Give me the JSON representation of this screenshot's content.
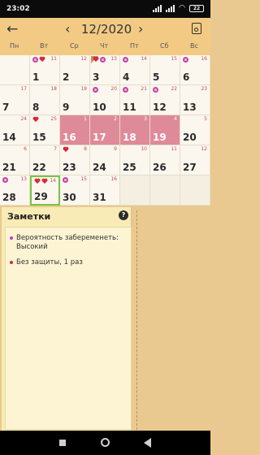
{
  "status_bar": {
    "time": "23:02",
    "battery": "22",
    "icons": [
      "signal-icon",
      "signal-icon",
      "wifi-icon",
      "battery-icon"
    ]
  },
  "header": {
    "back_icon": "arrow-left-icon",
    "prev_icon": "chevron-left-icon",
    "month_year": "12/2020",
    "next_icon": "chevron-right-icon",
    "calendar_icon": "calendar-settings-icon"
  },
  "weekdays": [
    "Пн",
    "Вт",
    "Ср",
    "Чт",
    "Пт",
    "Сб",
    "Вс"
  ],
  "calendar": {
    "weeks": [
      [
        {
          "day": "",
          "sup": ""
        },
        {
          "day": "1",
          "sup": "11",
          "icons": [
            "ring",
            "heart"
          ]
        },
        {
          "day": "2",
          "sup": "12"
        },
        {
          "day": "3",
          "sup": "13",
          "icons": [
            "heart",
            "ring"
          ],
          "note": true
        },
        {
          "day": "4",
          "sup": "14",
          "icons": [
            "ring"
          ]
        },
        {
          "day": "5",
          "sup": "15"
        },
        {
          "day": "6",
          "sup": "16",
          "icons": [
            "ring"
          ]
        }
      ],
      [
        {
          "day": "7",
          "sup": "17"
        },
        {
          "day": "8",
          "sup": "18"
        },
        {
          "day": "9",
          "sup": "19"
        },
        {
          "day": "10",
          "sup": "20",
          "icons": [
            "ring"
          ]
        },
        {
          "day": "11",
          "sup": "21",
          "icons": [
            "ring"
          ]
        },
        {
          "day": "12",
          "sup": "22",
          "icons": [
            "ring"
          ]
        },
        {
          "day": "13",
          "sup": "23"
        }
      ],
      [
        {
          "day": "14",
          "sup": "24"
        },
        {
          "day": "15",
          "sup": "25",
          "icons": [
            "heart"
          ]
        },
        {
          "day": "16",
          "sup": "1",
          "pink": true
        },
        {
          "day": "17",
          "sup": "2",
          "pink": true
        },
        {
          "day": "18",
          "sup": "3",
          "pink": true
        },
        {
          "day": "19",
          "sup": "4",
          "pink": true
        },
        {
          "day": "20",
          "sup": "5"
        }
      ],
      [
        {
          "day": "21",
          "sup": "6"
        },
        {
          "day": "22",
          "sup": "7"
        },
        {
          "day": "23",
          "sup": "8",
          "icons": [
            "heart"
          ]
        },
        {
          "day": "24",
          "sup": "9"
        },
        {
          "day": "25",
          "sup": "10"
        },
        {
          "day": "26",
          "sup": "11"
        },
        {
          "day": "27",
          "sup": "12"
        }
      ],
      [
        {
          "day": "28",
          "sup": "13",
          "icons": [
            "ring"
          ]
        },
        {
          "day": "29",
          "sup": "14",
          "icons": [
            "heart",
            "heart"
          ],
          "selected": true
        },
        {
          "day": "30",
          "sup": "15",
          "icons": [
            "ring"
          ]
        },
        {
          "day": "31",
          "sup": "16"
        },
        {
          "day": "",
          "sup": "",
          "blank": true
        },
        {
          "day": "",
          "sup": "",
          "blank": true
        },
        {
          "day": "",
          "sup": "",
          "blank": true
        }
      ]
    ]
  },
  "notes": {
    "title": "Заметки",
    "help_icon": "help-icon",
    "help_label": "?",
    "items": [
      {
        "text": "Вероятность забеременеть: Высокий",
        "bullet_color": "#c33ec5"
      },
      {
        "text": "Без защиты, 1 раз",
        "bullet_color": "#d8283e"
      }
    ]
  },
  "nav_bar": {
    "recents_icon": "square-icon",
    "home_icon": "circle-icon",
    "back_icon": "triangle-back-icon"
  },
  "colors": {
    "header_bg": "#f2ca84",
    "period": "#df8a98",
    "selected_border": "#79c442",
    "heart": "#d8283e",
    "ovulation_ring": "#c33ec5"
  }
}
